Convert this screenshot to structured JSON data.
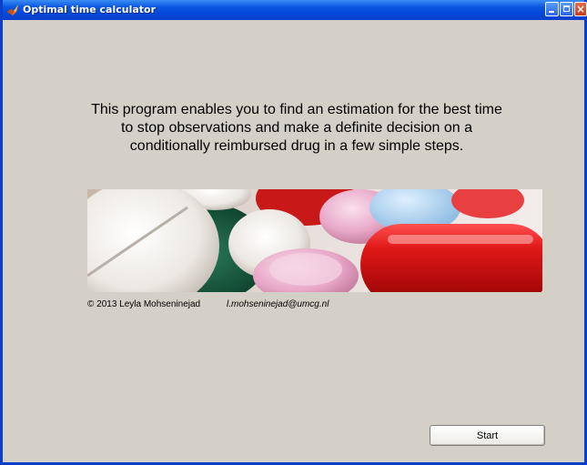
{
  "window": {
    "title": "Optimal time calculator",
    "title_bar_color": "#0a56e0",
    "background_color": "#d4d0c8",
    "controls": [
      "minimize-icon",
      "maximize-icon",
      "close-icon"
    ],
    "close_glyph": "×"
  },
  "main": {
    "intro_text": "This program enables you to find an estimation for the best time to stop observations and make a definite decision on a conditionally reimbursed drug in a few simple steps.",
    "banner_image": "pills-photo",
    "copyright": "© 2013 Leyla Mohseninejad",
    "email": "l.mohseninejad@umcg.nl",
    "start_label": "Start"
  }
}
